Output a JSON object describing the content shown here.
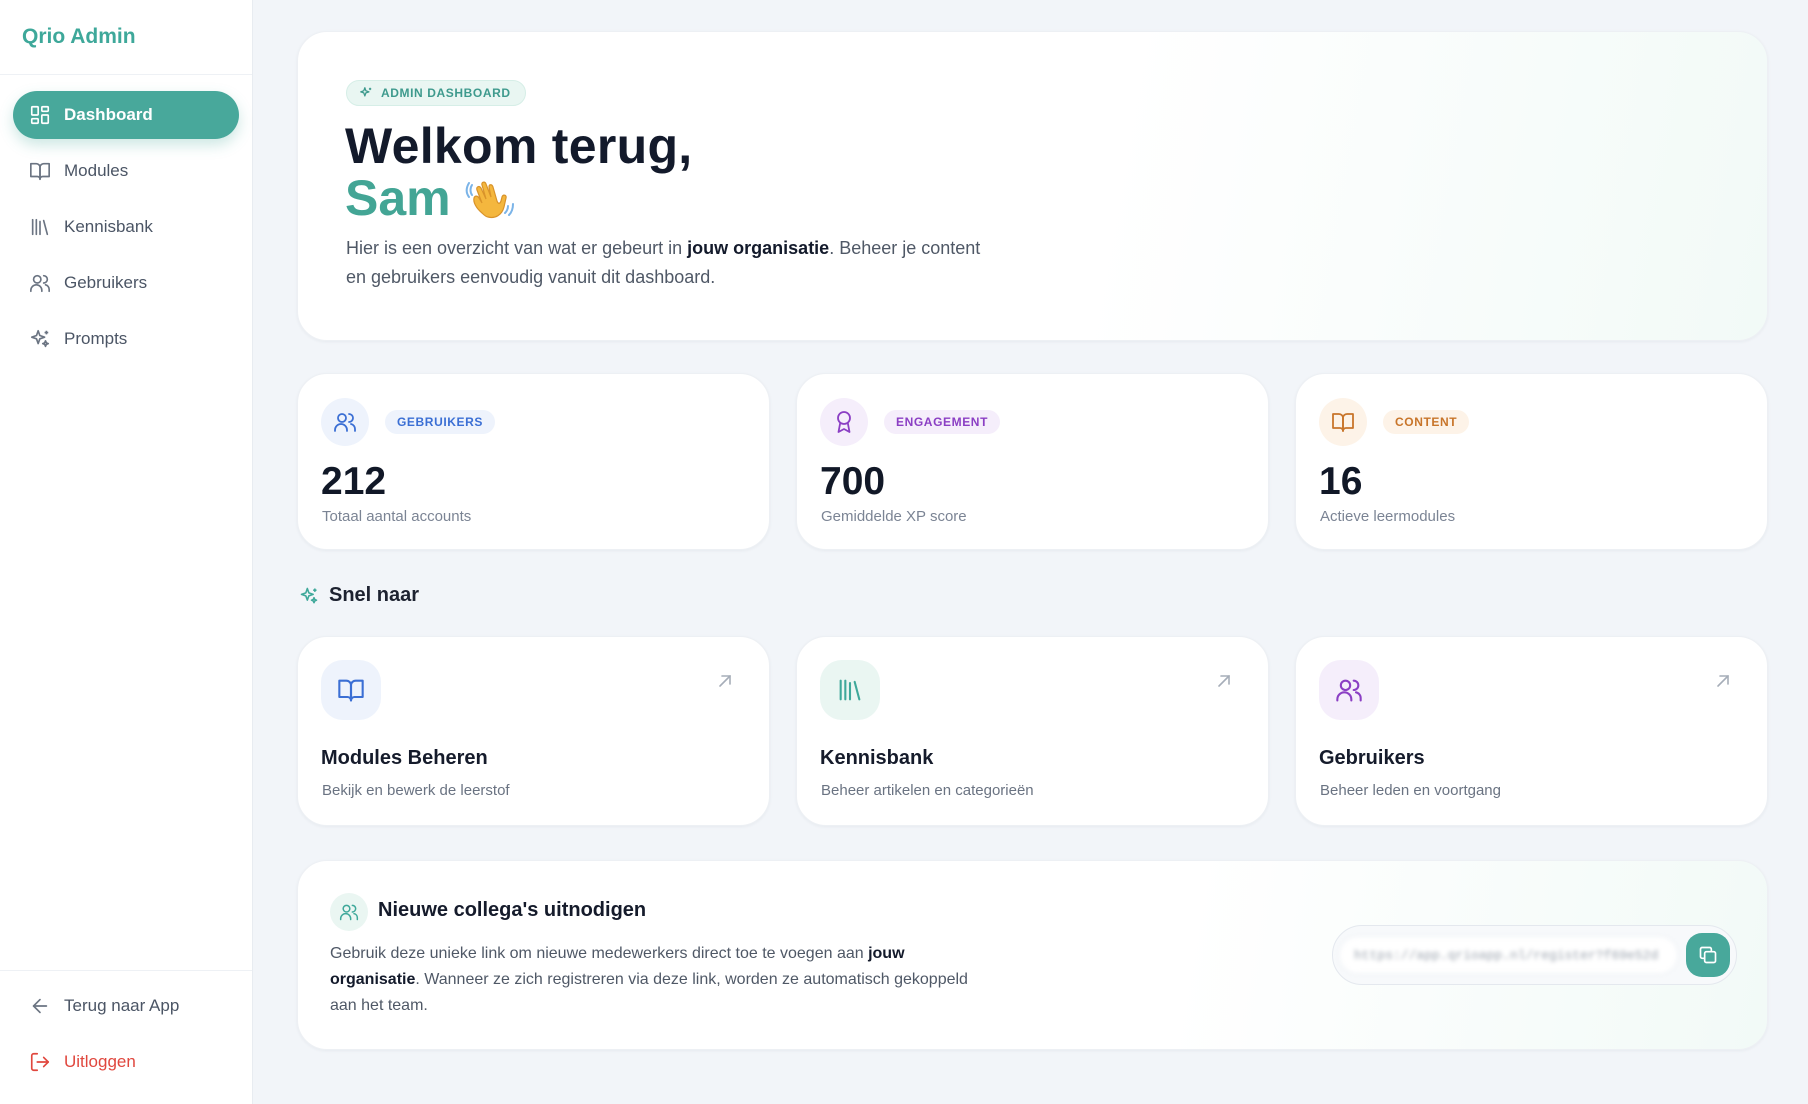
{
  "brand": "Qrio Admin",
  "sidebar": {
    "items": [
      {
        "label": "Dashboard",
        "icon": "dashboard-icon",
        "active": true
      },
      {
        "label": "Modules",
        "icon": "book-open-icon"
      },
      {
        "label": "Kennisbank",
        "icon": "library-icon"
      },
      {
        "label": "Gebruikers",
        "icon": "users-icon"
      },
      {
        "label": "Prompts",
        "icon": "sparkles-icon"
      }
    ],
    "bottom": [
      {
        "label": "Terug naar App",
        "icon": "arrow-left-icon"
      },
      {
        "label": "Uitloggen",
        "icon": "logout-icon"
      }
    ]
  },
  "hero": {
    "badge": "ADMIN DASHBOARD",
    "title": "Welkom terug,",
    "name": "Sam",
    "text_before": "Hier is een overzicht van wat er gebeurt in ",
    "text_bold": "jouw organisatie",
    "text_after": ". Beheer je content en gebruikers eenvoudig vanuit dit dashboard."
  },
  "stats": [
    {
      "tag": "GEBRUIKERS",
      "value": "212",
      "label": "Totaal aantal accounts",
      "icon": "users-icon",
      "color": "#3b6fd4",
      "bg": "#eef3fc"
    },
    {
      "tag": "ENGAGEMENT",
      "value": "700",
      "label": "Gemiddelde XP score",
      "icon": "award-icon",
      "color": "#8b3fc4",
      "bg": "#f5eefb"
    },
    {
      "tag": "CONTENT",
      "value": "16",
      "label": "Actieve leermodules",
      "icon": "book-open-icon",
      "color": "#c8752a",
      "bg": "#fdf3e8"
    }
  ],
  "quick_title": "Snel naar",
  "quick": [
    {
      "title": "Modules Beheren",
      "sub": "Bekijk en bewerk de leerstof",
      "icon": "book-open-icon",
      "color": "#3b6fd4",
      "bg": "#eef3fc"
    },
    {
      "title": "Kennisbank",
      "sub": "Beheer artikelen en categorieën",
      "icon": "library-icon",
      "color": "#3ea89a",
      "bg": "#eaf6f2"
    },
    {
      "title": "Gebruikers",
      "sub": "Beheer leden en voortgang",
      "icon": "users-icon",
      "color": "#8b3fc4",
      "bg": "#f5eefb"
    }
  ],
  "invite": {
    "title": "Nieuwe collega's uitnodigen",
    "text_before": "Gebruik deze unieke link om nieuwe medewerkers direct toe te voegen aan ",
    "text_bold": "jouw organisatie",
    "text_after": ". Wanneer ze zich registreren via deze link, worden ze automatisch gekoppeld aan het team.",
    "link": "https://app.qrioapp.nl/register?f69e52d"
  },
  "colors": {
    "accent": "#48a89b",
    "danger": "#e0473e"
  }
}
